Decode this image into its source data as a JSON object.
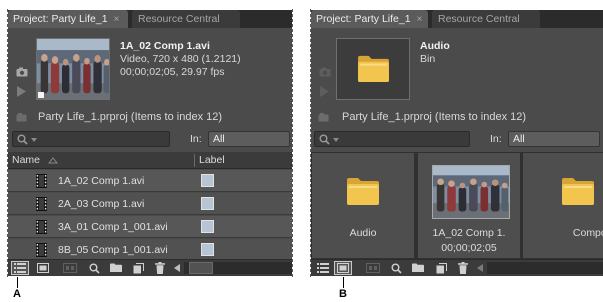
{
  "colors": {
    "label_swatch": "#b6c4d4",
    "folder_front": "#f2c54e",
    "folder_back": "#d9a436",
    "folder_highlight": "#f8dc86"
  },
  "panel_a": {
    "callout": "A",
    "tabs": {
      "project": "Project: Party Life_1",
      "close": "×",
      "resource": "Resource Central"
    },
    "preview": {
      "title": "1A_02 Comp 1.avi",
      "line1": "Video, 720 x 480 (1.2121)",
      "line2": "00;00;02;05, 29.97 fps"
    },
    "project_file": "Party Life_1.prproj (Items to index 12)",
    "search": {
      "in_label": "In:",
      "in_value": "All"
    },
    "columns": {
      "name": "Name",
      "label": "Label"
    },
    "rows": [
      {
        "name": "1A_02 Comp 1.avi"
      },
      {
        "name": "2A_03 Comp 1.avi"
      },
      {
        "name": "3A_01 Comp 1_001.avi"
      },
      {
        "name": "8B_05 Comp 1_001.avi"
      }
    ],
    "active_toolbar_icon": "list-view-icon"
  },
  "panel_b": {
    "callout": "B",
    "tabs": {
      "project": "Project: Party Life_1",
      "close": "×",
      "resource": "Resource Central"
    },
    "preview": {
      "title": "Audio",
      "line1": "Bin"
    },
    "project_file": "Party Life_1.prproj (Items to index 12)",
    "search": {
      "in_label": "In:",
      "in_value": "All"
    },
    "items": [
      {
        "name": "Audio"
      },
      {
        "name": "1A_02 Comp 1.",
        "duration": "00;00;02;05"
      },
      {
        "name": "Composite"
      }
    ],
    "active_toolbar_icon": "icon-view-icon"
  }
}
